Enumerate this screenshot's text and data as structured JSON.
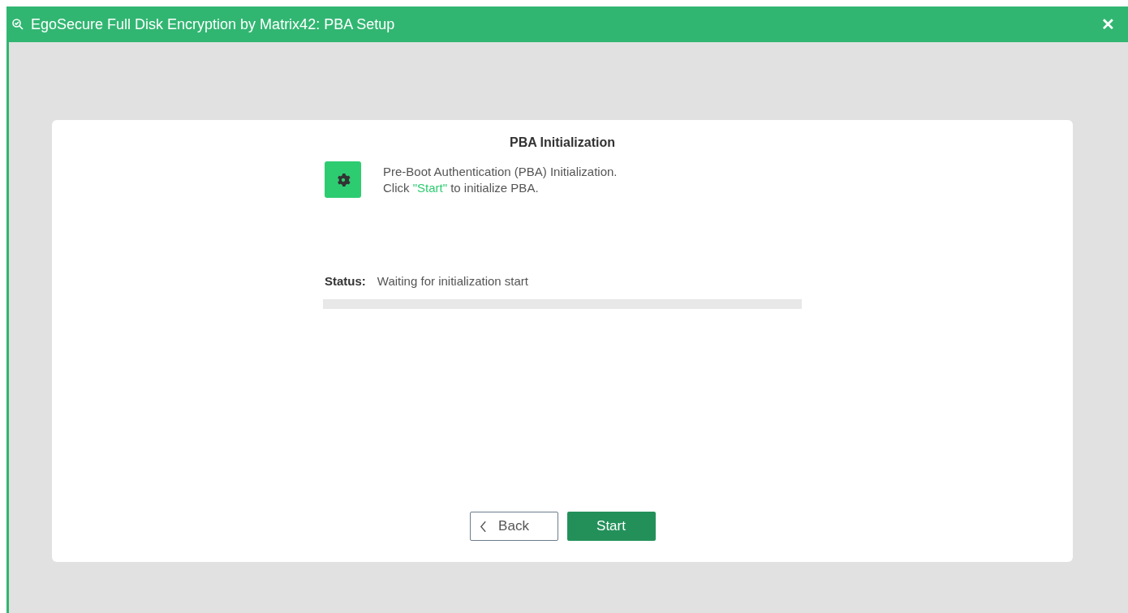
{
  "window": {
    "title": "EgoSecure Full Disk Encryption by Matrix42: PBA Setup",
    "close": "✕"
  },
  "card": {
    "heading": "PBA Initialization",
    "description": {
      "line_1": "Pre-Boot Authentication (PBA) Initialization.",
      "line_2_before": "Click ",
      "line_2_highlight": "\"Start\"",
      "line_2_after": " to initialize PBA."
    },
    "status": {
      "label": "Status:",
      "value": "Waiting for initialization start"
    },
    "progress": {
      "level": 0
    },
    "buttons": [
      {
        "kind": "back",
        "label": "Back"
      },
      {
        "kind": "primary",
        "label": "Start"
      }
    ]
  }
}
